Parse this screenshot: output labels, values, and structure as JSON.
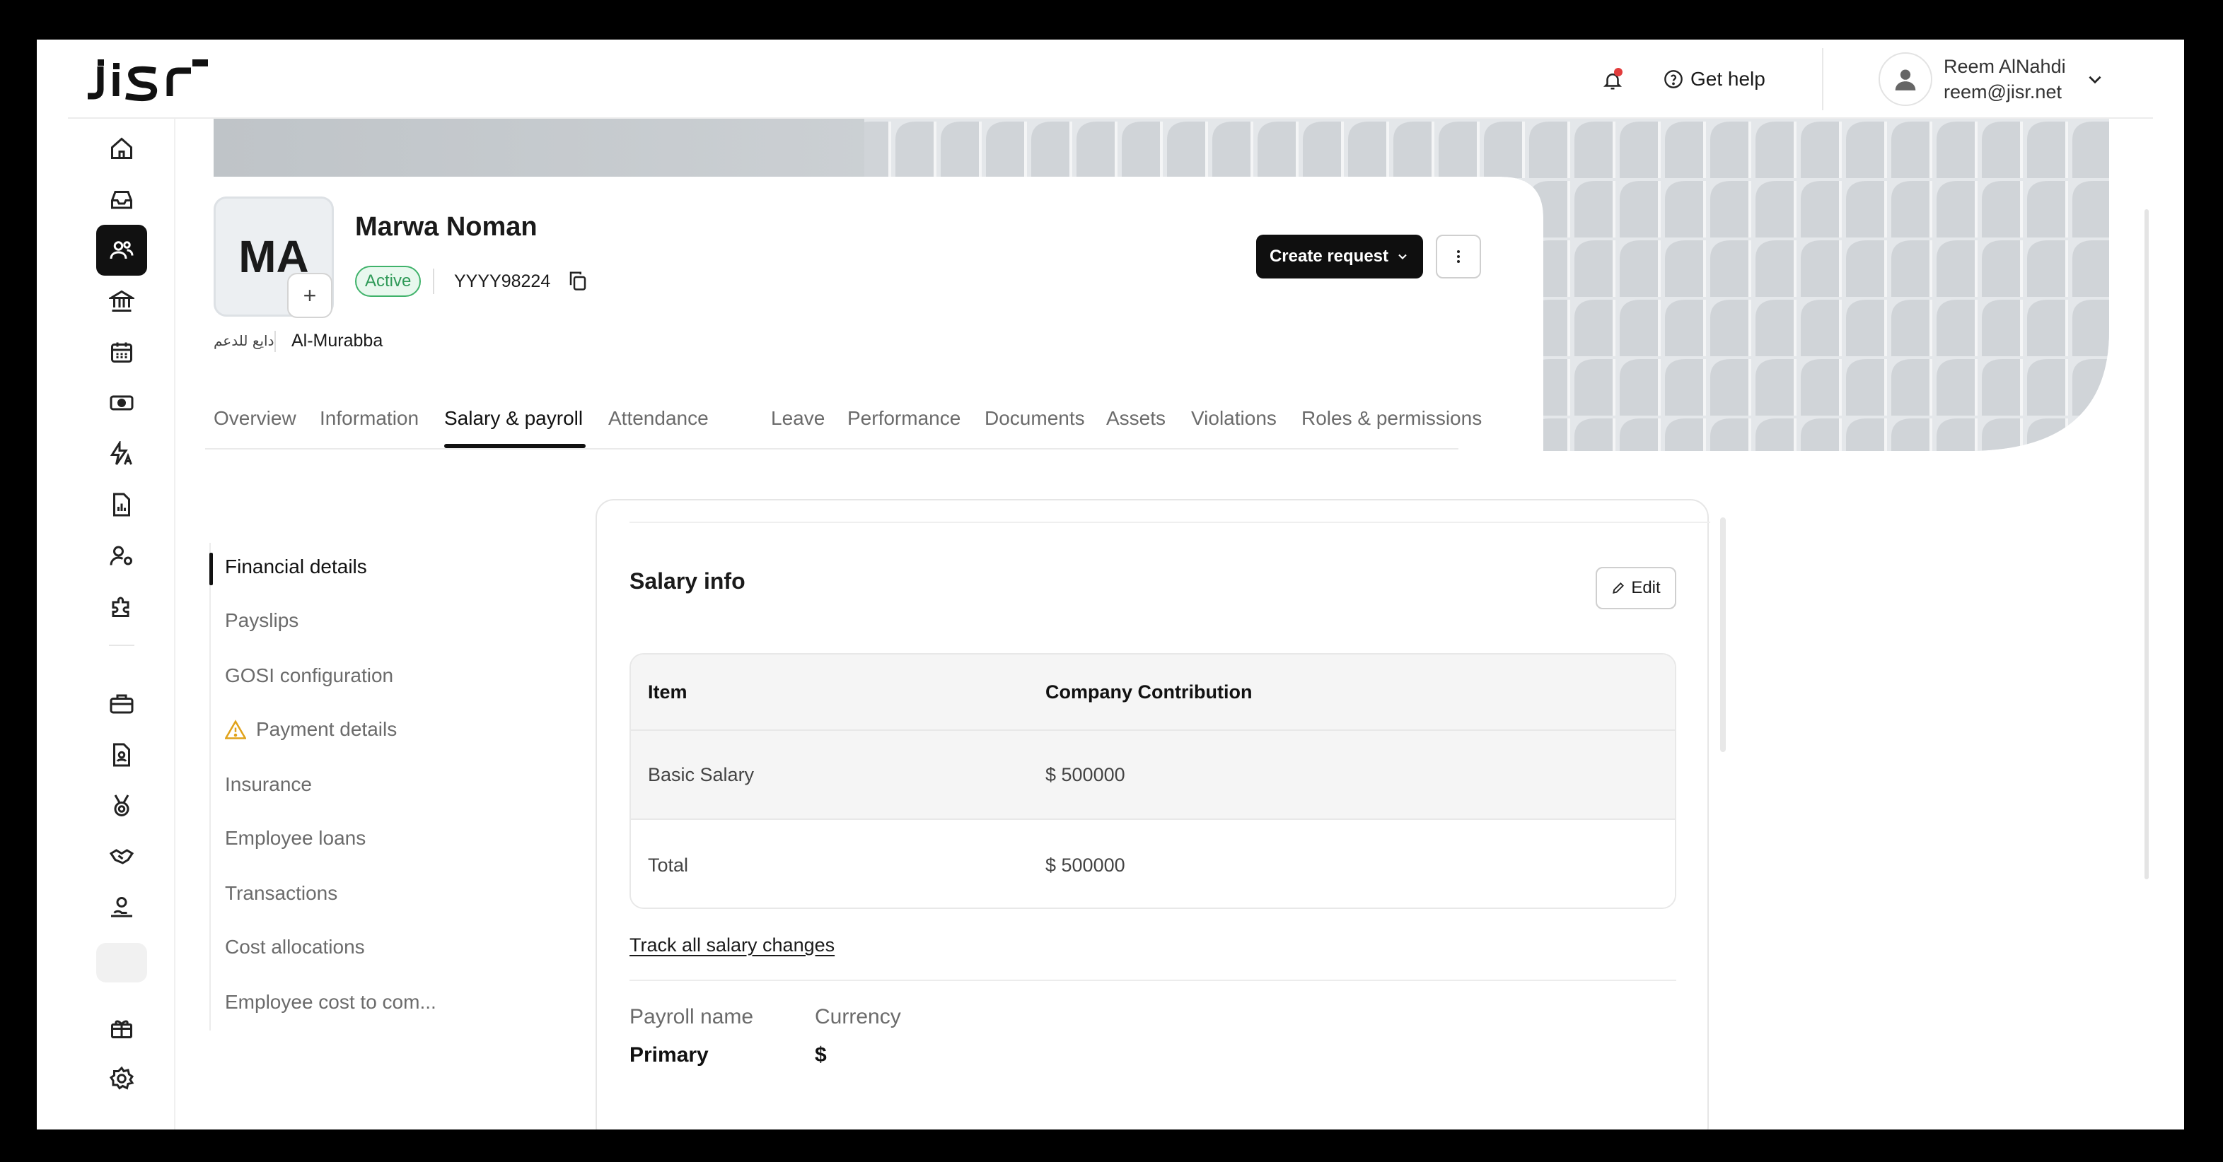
{
  "app": {
    "logo_text": "JISr"
  },
  "header": {
    "help_label": "Get help",
    "user_name": "Reem AlNahdi",
    "user_email": "reem@jisr.net"
  },
  "sidebar": {
    "items": [
      "home-icon",
      "inbox-icon",
      "employees-icon",
      "bank-icon",
      "calendar-icon",
      "money-icon",
      "automation-icon",
      "reports-icon",
      "user-settings-icon",
      "integrations-icon",
      "briefcase-icon",
      "id-card-icon",
      "medal-icon",
      "handshake-icon",
      "hand-money-icon",
      "gift-icon",
      "settings-icon"
    ],
    "active": "employees-icon"
  },
  "profile": {
    "initials": "MA",
    "name": "Marwa Noman",
    "status": "Active",
    "employee_id": "YYYY98224",
    "company_ar": "دايع للدعم",
    "location": "Al-Murabba",
    "create_request_label": "Create request"
  },
  "tabs": [
    {
      "label": "Overview"
    },
    {
      "label": "Information"
    },
    {
      "label": "Salary & payroll"
    },
    {
      "label": "Attendance"
    },
    {
      "label": "Leave"
    },
    {
      "label": "Performance"
    },
    {
      "label": "Documents"
    },
    {
      "label": "Assets"
    },
    {
      "label": "Violations"
    },
    {
      "label": "Roles & permissions"
    }
  ],
  "active_tab": "Salary & payroll",
  "subnav": [
    {
      "label": "Financial details"
    },
    {
      "label": "Payslips"
    },
    {
      "label": "GOSI configuration"
    },
    {
      "label": "Payment details"
    },
    {
      "label": "Insurance"
    },
    {
      "label": "Employee loans"
    },
    {
      "label": "Transactions"
    },
    {
      "label": "Cost allocations"
    },
    {
      "label": "Employee cost to com..."
    }
  ],
  "salary_info": {
    "title": "Salary info",
    "edit_label": "Edit",
    "columns": [
      "Item",
      "Company Contribution"
    ],
    "rows": [
      {
        "item": "Basic Salary",
        "value": "$ 500000"
      },
      {
        "item": "Total",
        "value": "$ 500000"
      }
    ],
    "track_link": "Track all salary changes"
  },
  "payroll": {
    "payroll_name_label": "Payroll name",
    "currency_label": "Currency",
    "payroll_name": "Primary",
    "currency": "$"
  },
  "colors": {
    "status_green": "#2f9a58",
    "notification_dot": "#e23c3c",
    "warning": "#e0a21a"
  }
}
